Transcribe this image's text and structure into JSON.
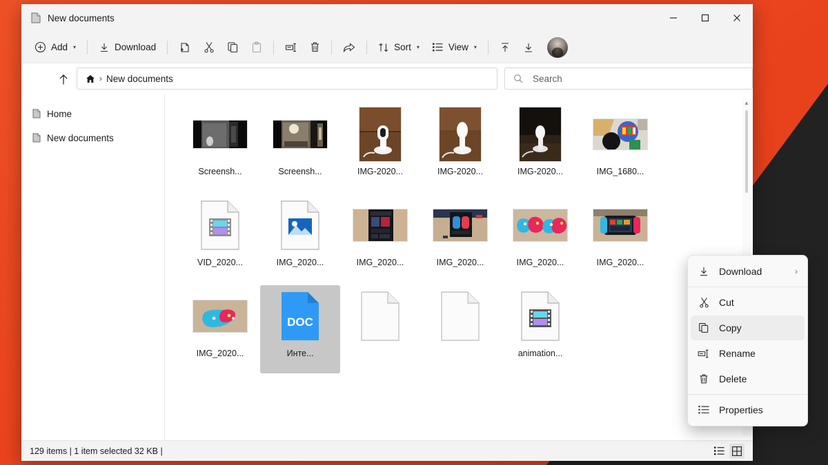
{
  "window": {
    "title": "New documents",
    "title_icon": "page-icon",
    "controls": {
      "minimize": "–",
      "maximize": "□",
      "close": "✕"
    }
  },
  "toolbar": {
    "items": [
      {
        "label": "Add",
        "icon": "plus-circle-icon",
        "caret": "▾",
        "disabled": false
      },
      {
        "label": "Download",
        "icon": "download-icon",
        "caret": "",
        "disabled": false
      },
      {
        "label": "",
        "icon": "new-folder-icon",
        "caret": "",
        "disabled": false
      },
      {
        "label": "",
        "icon": "cut-icon",
        "caret": "",
        "disabled": false
      },
      {
        "label": "",
        "icon": "copy-icon",
        "caret": "",
        "disabled": false
      },
      {
        "label": "",
        "icon": "paste-icon",
        "caret": "",
        "disabled": true
      },
      {
        "label": "",
        "icon": "rename-icon",
        "caret": "",
        "disabled": false
      },
      {
        "label": "",
        "icon": "delete-icon",
        "caret": "",
        "disabled": false
      },
      {
        "label": "",
        "icon": "share-icon",
        "caret": "",
        "disabled": false
      },
      {
        "label": "Sort",
        "icon": "sort-icon",
        "caret": "▾",
        "disabled": false
      },
      {
        "label": "View",
        "icon": "view-icon",
        "caret": "▾",
        "disabled": false
      },
      {
        "label": "",
        "icon": "upload-icon",
        "caret": "",
        "disabled": false
      },
      {
        "label": "",
        "icon": "download-file-icon",
        "caret": "",
        "disabled": false
      }
    ],
    "avatar": "user-avatar"
  },
  "address": {
    "up_icon": "up-arrow-icon",
    "home_icon": "home-icon",
    "separator": "›",
    "crumb": "New documents"
  },
  "search": {
    "icon": "search-icon",
    "placeholder": "Search",
    "value": ""
  },
  "sidebar": {
    "items": [
      {
        "label": "Home",
        "icon": "page-icon"
      },
      {
        "label": "New documents",
        "icon": "page-icon"
      }
    ]
  },
  "files": [
    {
      "name": "Screensh...",
      "kind": "photo-dark-room-bw",
      "selected": false
    },
    {
      "name": "Screensh...",
      "kind": "photo-dark-room-color",
      "selected": false
    },
    {
      "name": "IMG-2020...",
      "kind": "photo-camera-wood",
      "selected": false
    },
    {
      "name": "IMG-2020...",
      "kind": "photo-lamp-wood",
      "selected": false
    },
    {
      "name": "IMG-2020...",
      "kind": "photo-lamp-dark",
      "selected": false
    },
    {
      "name": "IMG_1680...",
      "kind": "photo-colorful-table",
      "selected": false
    },
    {
      "name": "VID_2020...",
      "kind": "video-file-icon",
      "selected": false
    },
    {
      "name": "IMG_2020...",
      "kind": "image-file-icon",
      "selected": false
    },
    {
      "name": "IMG_2020...",
      "kind": "photo-box-back",
      "selected": false
    },
    {
      "name": "IMG_2020...",
      "kind": "photo-box-front",
      "selected": false
    },
    {
      "name": "IMG_2020...",
      "kind": "photo-joycons-pair",
      "selected": false
    },
    {
      "name": "IMG_2020...",
      "kind": "photo-switch-console",
      "selected": false
    },
    {
      "name": "IMG_2020...",
      "kind": "photo-joycon-blue",
      "selected": false
    },
    {
      "name": "Инте...",
      "kind": "doc-file-icon",
      "selected": true
    },
    {
      "name": "",
      "kind": "blank-file-icon",
      "selected": false
    },
    {
      "name": "",
      "kind": "blank-file-icon",
      "selected": false
    },
    {
      "name": "animation...",
      "kind": "video-file-icon",
      "selected": false
    }
  ],
  "doc_icon_label": "DOC",
  "contextmenu": {
    "items": [
      {
        "label": "Download",
        "icon": "download-icon",
        "submenu": "›",
        "hovered": false,
        "sep_after": true
      },
      {
        "label": "Cut",
        "icon": "cut-icon",
        "submenu": "",
        "hovered": false,
        "sep_after": false
      },
      {
        "label": "Copy",
        "icon": "copy-icon",
        "submenu": "",
        "hovered": true,
        "sep_after": false
      },
      {
        "label": "Rename",
        "icon": "rename-icon",
        "submenu": "",
        "hovered": false,
        "sep_after": false
      },
      {
        "label": "Delete",
        "icon": "delete-icon",
        "submenu": "",
        "hovered": false,
        "sep_after": true
      },
      {
        "label": "Properties",
        "icon": "properties-icon",
        "submenu": "",
        "hovered": false,
        "sep_after": false
      }
    ]
  },
  "statusbar": {
    "text": "129 items | 1 item selected 32 KB |",
    "view_list_icon": "details-view-icon",
    "view_grid_icon": "grid-view-icon"
  },
  "colors": {
    "wallpaper_orange": "#ee4b23",
    "wallpaper_dark": "#222222",
    "window_chrome": "#f3f3f3",
    "selection": "#c7c7c7",
    "doc_blue": "#2f9af5"
  }
}
